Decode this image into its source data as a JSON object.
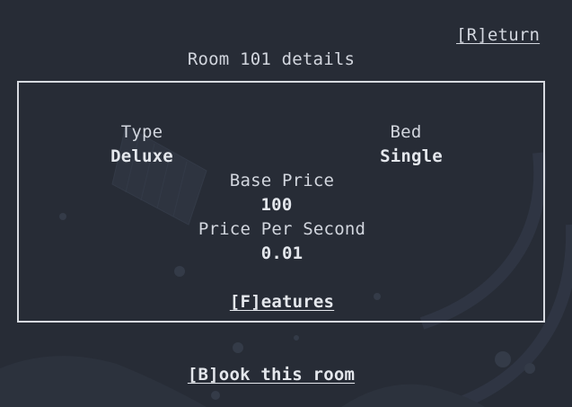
{
  "return_label": "[R]eturn",
  "title": "Room 101 details",
  "details": {
    "type_label": "Type",
    "type_value": "Deluxe",
    "bed_label": "Bed",
    "bed_value": "Single",
    "base_price_label": "Base Price",
    "base_price_value": "100",
    "price_per_second_label": "Price Per Second",
    "price_per_second_value": "0.01"
  },
  "features_label": "[F]eatures",
  "book_label": "[B]ook this room"
}
